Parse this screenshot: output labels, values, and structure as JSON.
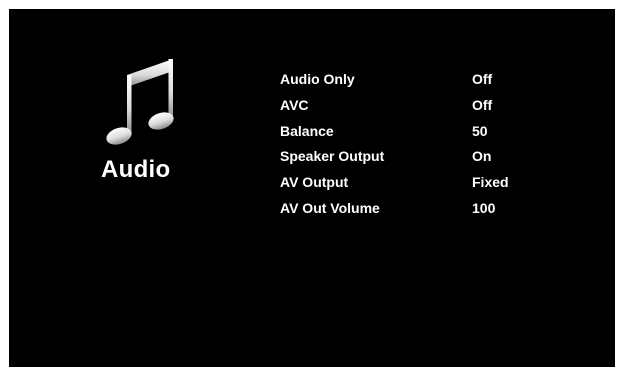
{
  "page": {
    "title": "Audio",
    "icon": "music-note-icon"
  },
  "menu": {
    "items": [
      {
        "label": "Audio Only",
        "value": "Off"
      },
      {
        "label": "AVC",
        "value": "Off"
      },
      {
        "label": "Balance",
        "value": "50"
      },
      {
        "label": "Speaker Output",
        "value": "On"
      },
      {
        "label": "AV Output",
        "value": "Fixed"
      },
      {
        "label": "AV Out Volume",
        "value": "100"
      }
    ]
  },
  "colors": {
    "background": "#000000",
    "text": "#ffffff",
    "border": "#ffffff"
  }
}
